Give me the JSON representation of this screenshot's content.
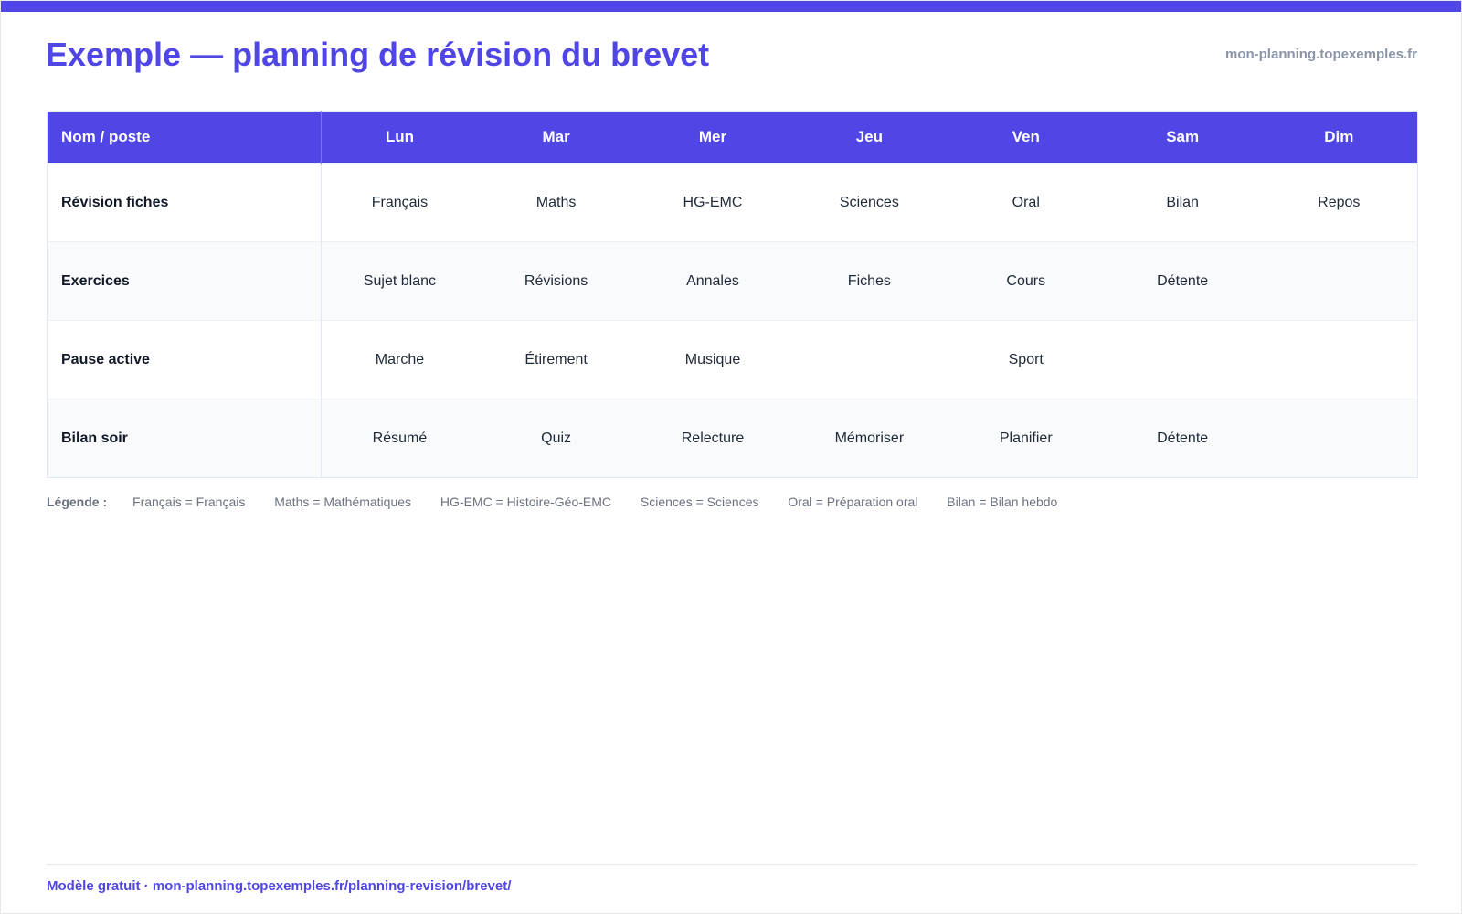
{
  "header": {
    "title": "Exemple — planning de révision du brevet",
    "site": "mon-planning.topexemples.fr"
  },
  "table": {
    "corner_label": "Nom / poste",
    "days": [
      "Lun",
      "Mar",
      "Mer",
      "Jeu",
      "Ven",
      "Sam",
      "Dim"
    ],
    "rows": [
      {
        "label": "Révision fiches",
        "cells": [
          "Français",
          "Maths",
          "HG-EMC",
          "Sciences",
          "Oral",
          "Bilan",
          "Repos"
        ]
      },
      {
        "label": "Exercices",
        "cells": [
          "Sujet blanc",
          "Révisions",
          "Annales",
          "Fiches",
          "Cours",
          "Détente",
          ""
        ]
      },
      {
        "label": "Pause active",
        "cells": [
          "Marche",
          "Étirement",
          "Musique",
          "",
          "Sport",
          "",
          ""
        ]
      },
      {
        "label": "Bilan soir",
        "cells": [
          "Résumé",
          "Quiz",
          "Relecture",
          "Mémoriser",
          "Planifier",
          "Détente",
          ""
        ]
      }
    ]
  },
  "legend": {
    "title": "Légende :",
    "items": [
      "Français = Français",
      "Maths = Mathématiques",
      "HG-EMC = Histoire-Géo-EMC",
      "Sciences = Sciences",
      "Oral = Préparation oral",
      "Bilan = Bilan hebdo"
    ]
  },
  "footer": {
    "text": "Modèle gratuit · mon-planning.topexemples.fr/planning-revision/brevet/"
  },
  "colors": {
    "accent": "#4f46e5",
    "row_stripe": "#f8fafc",
    "muted_text": "#6b7280"
  }
}
